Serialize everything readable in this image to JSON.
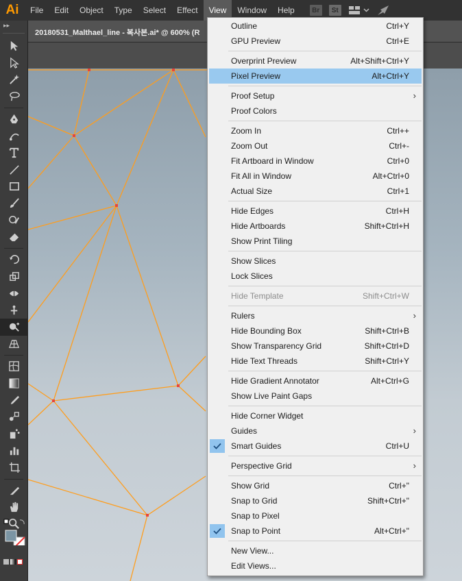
{
  "app": {
    "logo": "Ai"
  },
  "menubar": {
    "items": [
      "File",
      "Edit",
      "Object",
      "Type",
      "Select",
      "Effect",
      "View",
      "Window",
      "Help"
    ],
    "active_index": 6,
    "bridge_label": "Br",
    "stock_label": "St"
  },
  "document": {
    "tab_title": "20180531_Malthael_line  - 복사본.ai* @ 600% (R"
  },
  "view_menu": {
    "groups": [
      [
        {
          "label": "Outline",
          "shortcut": "Ctrl+Y"
        },
        {
          "label": "GPU Preview",
          "shortcut": "Ctrl+E"
        }
      ],
      [
        {
          "label": "Overprint Preview",
          "shortcut": "Alt+Shift+Ctrl+Y"
        },
        {
          "label": "Pixel Preview",
          "shortcut": "Alt+Ctrl+Y",
          "highlighted": true
        }
      ],
      [
        {
          "label": "Proof Setup",
          "submenu": true
        },
        {
          "label": "Proof Colors"
        }
      ],
      [
        {
          "label": "Zoom In",
          "shortcut": "Ctrl++"
        },
        {
          "label": "Zoom Out",
          "shortcut": "Ctrl+-"
        },
        {
          "label": "Fit Artboard in Window",
          "shortcut": "Ctrl+0"
        },
        {
          "label": "Fit All in Window",
          "shortcut": "Alt+Ctrl+0"
        },
        {
          "label": "Actual Size",
          "shortcut": "Ctrl+1"
        }
      ],
      [
        {
          "label": "Hide Edges",
          "shortcut": "Ctrl+H"
        },
        {
          "label": "Hide Artboards",
          "shortcut": "Shift+Ctrl+H"
        },
        {
          "label": "Show Print Tiling"
        }
      ],
      [
        {
          "label": "Show Slices"
        },
        {
          "label": "Lock Slices"
        }
      ],
      [
        {
          "label": "Hide Template",
          "shortcut": "Shift+Ctrl+W",
          "disabled": true
        }
      ],
      [
        {
          "label": "Rulers",
          "submenu": true
        },
        {
          "label": "Hide Bounding Box",
          "shortcut": "Shift+Ctrl+B"
        },
        {
          "label": "Show Transparency Grid",
          "shortcut": "Shift+Ctrl+D"
        },
        {
          "label": "Hide Text Threads",
          "shortcut": "Shift+Ctrl+Y"
        }
      ],
      [
        {
          "label": "Hide Gradient Annotator",
          "shortcut": "Alt+Ctrl+G"
        },
        {
          "label": "Show Live Paint Gaps"
        }
      ],
      [
        {
          "label": "Hide Corner Widget"
        },
        {
          "label": "Guides",
          "submenu": true
        },
        {
          "label": "Smart Guides",
          "shortcut": "Ctrl+U",
          "checked": true
        }
      ],
      [
        {
          "label": "Perspective Grid",
          "submenu": true
        }
      ],
      [
        {
          "label": "Show Grid",
          "shortcut": "Ctrl+\""
        },
        {
          "label": "Snap to Grid",
          "shortcut": "Shift+Ctrl+\""
        },
        {
          "label": "Snap to Pixel"
        },
        {
          "label": "Snap to Point",
          "shortcut": "Alt+Ctrl+\"",
          "checked": true
        }
      ],
      [
        {
          "label": "New View..."
        },
        {
          "label": "Edit Views..."
        }
      ]
    ]
  },
  "tools": [
    "selection-tool",
    "direct-selection-tool",
    "magic-wand-tool",
    "lasso-tool",
    "pen-tool",
    "curvature-tool",
    "type-tool",
    "line-segment-tool",
    "rectangle-tool",
    "paintbrush-tool",
    "shaper-tool",
    "eraser-tool",
    "rotate-tool",
    "scale-tool",
    "width-tool",
    "puppet-warp-tool",
    "shape-builder-tool",
    "perspective-grid-tool",
    "mesh-tool",
    "gradient-tool",
    "eyedropper-tool",
    "blend-tool",
    "symbol-sprayer-tool",
    "column-graph-tool",
    "artboard-tool",
    "slice-tool",
    "hand-tool",
    "zoom-tool"
  ],
  "selected_tool": "shape-builder-tool",
  "colors": {
    "accent_highlight": "#99c9ef",
    "check_bg": "#91c4ee",
    "path_stroke": "#ff9d1c",
    "anchor": "#e8453c",
    "logo": "#ff9a00"
  }
}
